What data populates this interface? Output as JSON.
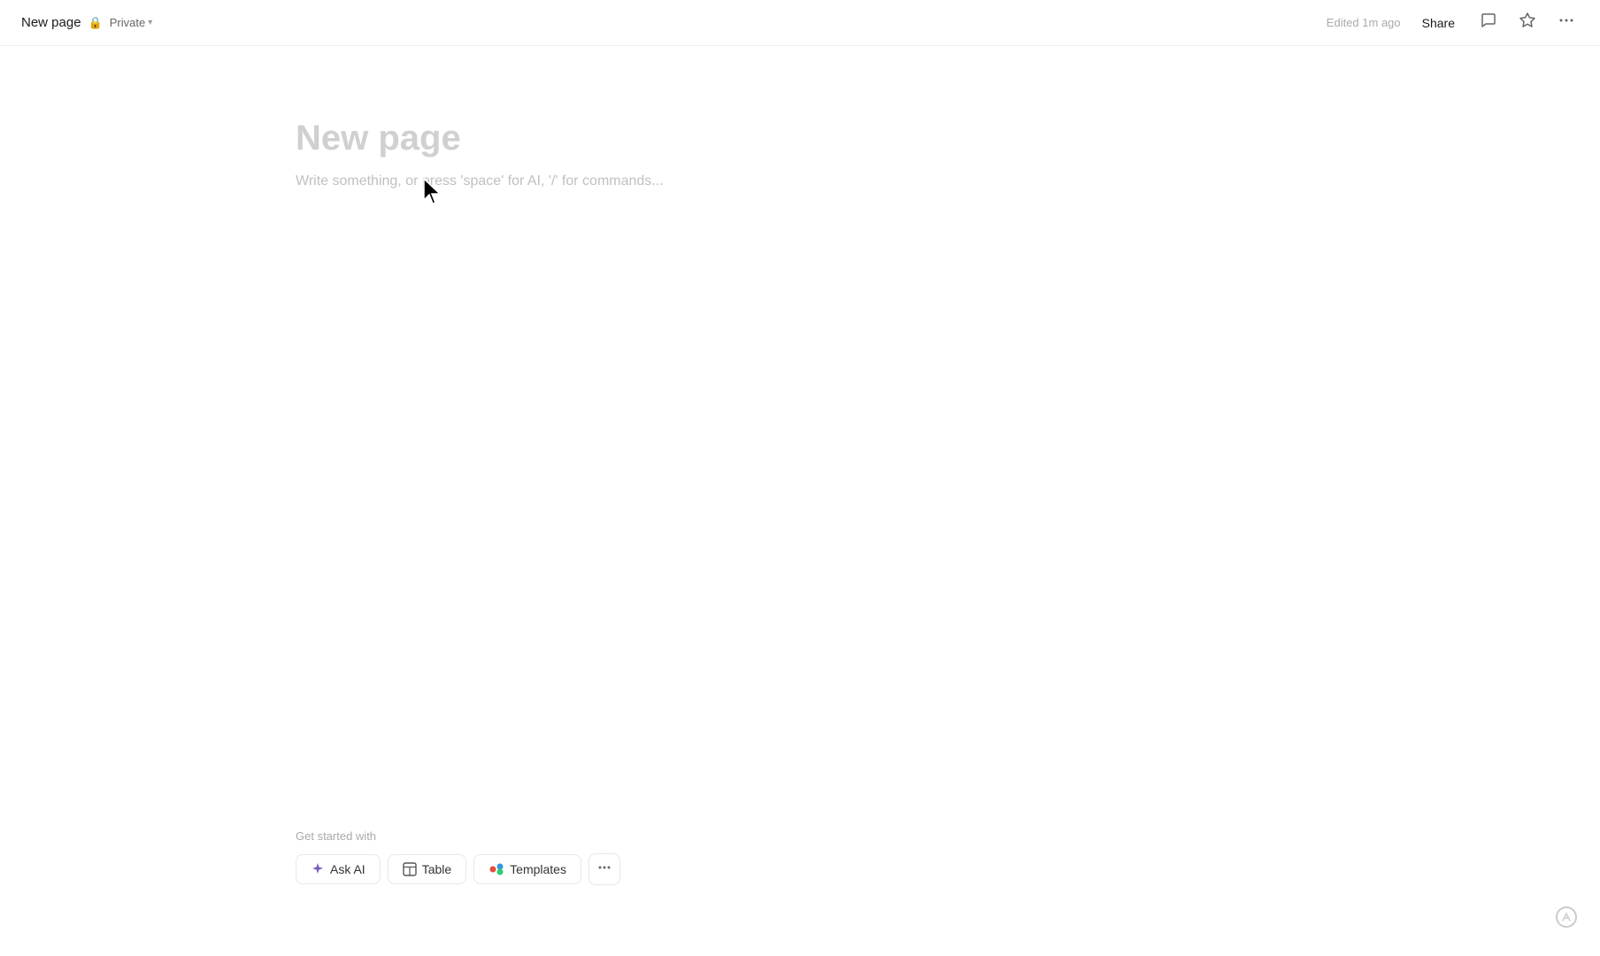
{
  "header": {
    "page_title": "New page",
    "lock_icon": "🔒",
    "privacy_label": "Private",
    "chevron": "▾",
    "edited_text": "Edited 1m ago",
    "share_label": "Share",
    "comment_icon": "💬",
    "star_icon": "☆",
    "more_icon": "···"
  },
  "main": {
    "page_title_placeholder": "New page",
    "body_placeholder": "Write something, or press 'space' for AI, '/' for commands..."
  },
  "bottom_toolbar": {
    "get_started_label": "Get started with",
    "buttons": [
      {
        "id": "ask-ai",
        "icon": "✦",
        "label": "Ask AI"
      },
      {
        "id": "table",
        "icon": "⊞",
        "label": "Table"
      },
      {
        "id": "templates",
        "icon": "◈",
        "label": "Templates"
      }
    ],
    "more_icon": "···"
  },
  "bottom_right": {
    "icon": "⌬"
  }
}
